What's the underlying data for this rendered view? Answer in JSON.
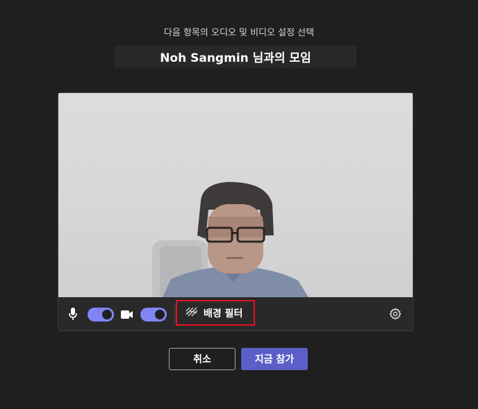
{
  "header": {
    "subtitle": "다음 항목의 오디오 및 비디오 설정 선택",
    "meeting_title": "Noh Sangmin 님과의 모임"
  },
  "controls": {
    "mic_icon": "microphone-icon",
    "mic_toggle_on": true,
    "camera_icon": "video-camera-icon",
    "camera_toggle_on": true,
    "background_filter_label": "배경 필터",
    "background_filter_icon": "background-effects-icon",
    "settings_icon": "gear-icon"
  },
  "buttons": {
    "cancel_label": "취소",
    "join_label": "지금 참가"
  },
  "colors": {
    "page_background": "#1f1f1f",
    "toggle_accent": "#7f85f5",
    "primary_button": "#5b5fc7",
    "highlight_border": "#e81123"
  }
}
